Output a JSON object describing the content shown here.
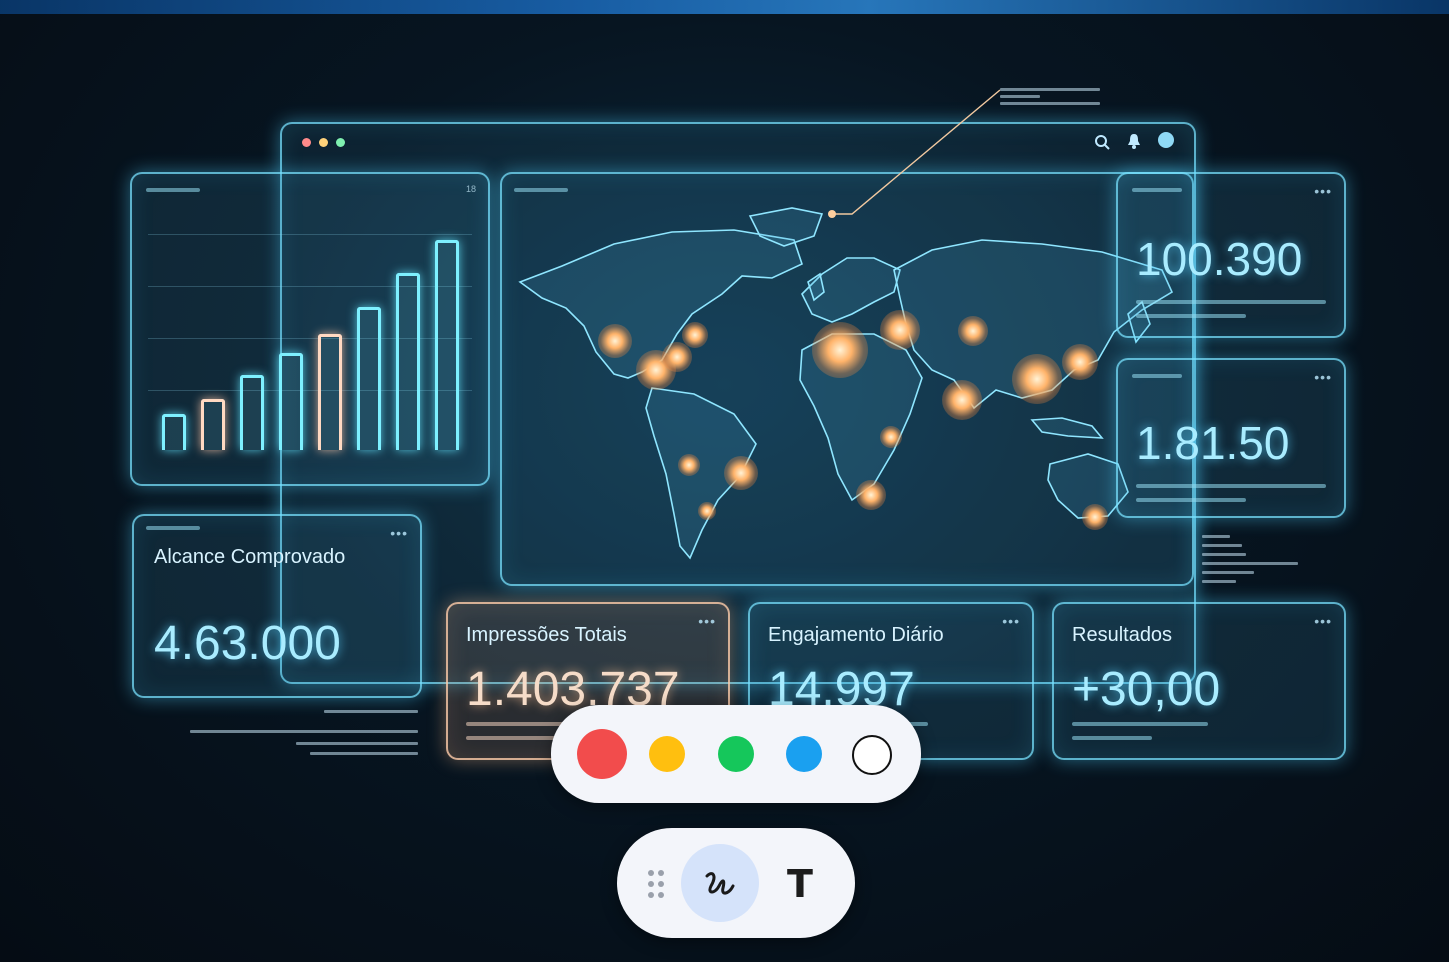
{
  "dashboard": {
    "metrics": {
      "reach": {
        "title": "Alcance Comprovado",
        "value": "4.63.000"
      },
      "impressions": {
        "title": "Impressões Totais",
        "value": "1.403.737"
      },
      "engagement": {
        "title": "Engajamento Diário",
        "value": "14.997"
      },
      "results": {
        "title": "Resultados",
        "value": "+30,00"
      },
      "right_top_value": "100.390",
      "right_mid_value": "1.81.50"
    },
    "chart_corner_label": "18",
    "more_glyph": "•••"
  },
  "chart_data": {
    "type": "bar",
    "values": [
      15,
      22,
      33,
      43,
      52,
      64,
      80,
      95
    ],
    "ylim": [
      0,
      100
    ]
  },
  "color_picker": {
    "colors": [
      "#f24c4c",
      "#ffbf0f",
      "#15c75b",
      "#1aa0f0",
      "#ffffff"
    ],
    "names": [
      "red",
      "yellow",
      "green",
      "blue",
      "white"
    ]
  },
  "tool_bar": {
    "text_tool_label": "T"
  }
}
